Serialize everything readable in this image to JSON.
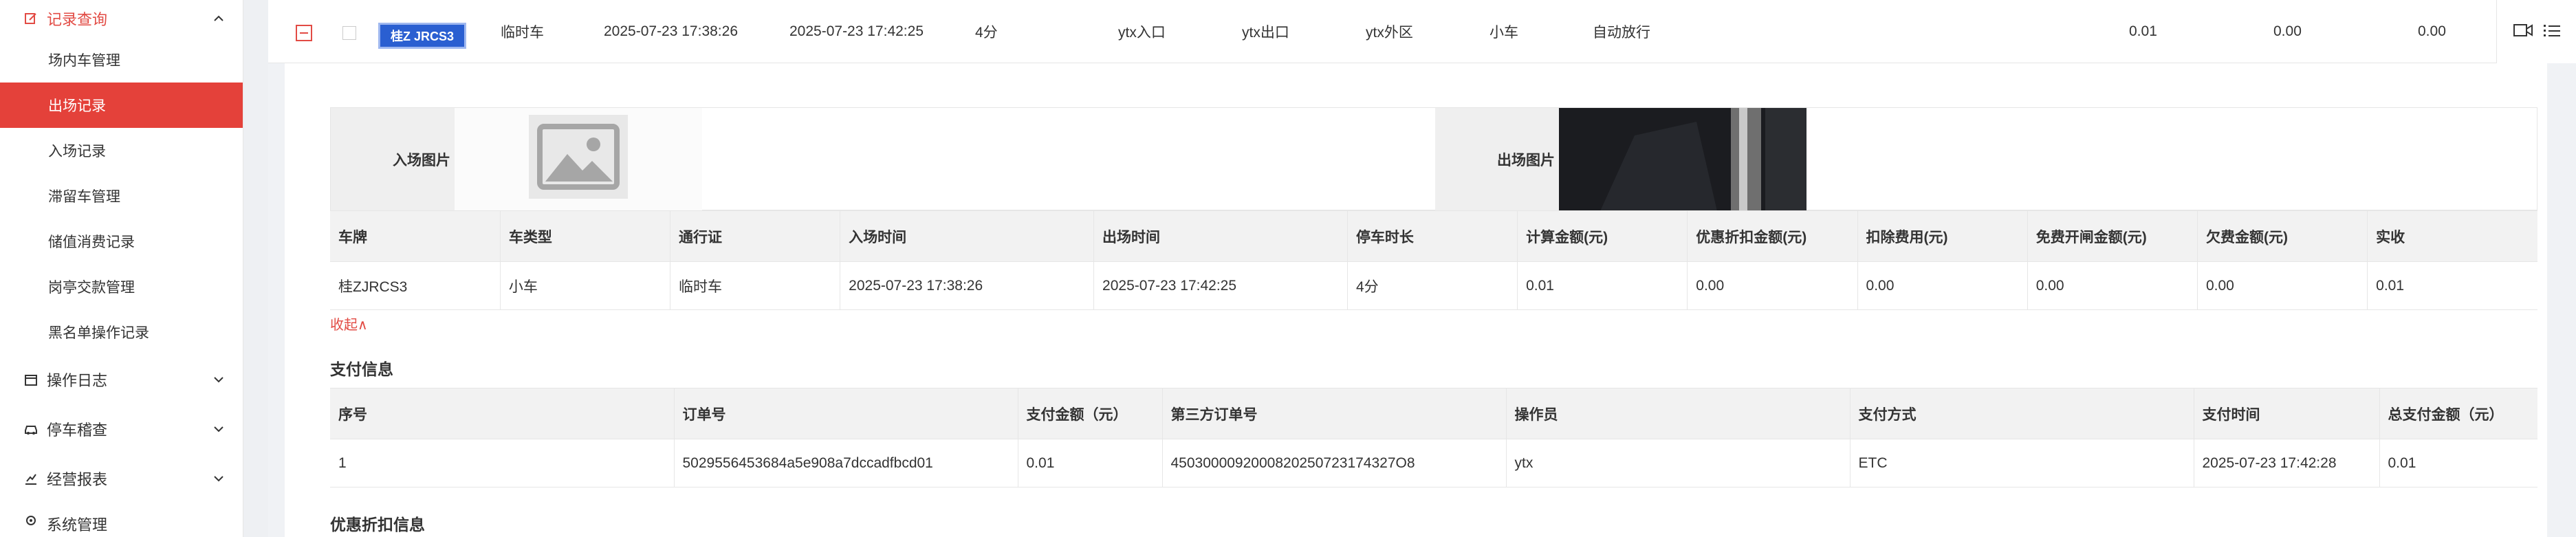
{
  "sidebar": {
    "record_query": "记录查询",
    "sub_items": [
      "场内车管理",
      "出场记录",
      "入场记录",
      "滞留车管理",
      "储值消费记录",
      "岗亭交款管理",
      "黑名单操作记录"
    ],
    "active_index": 1,
    "groups": [
      "操作日志",
      "停车稽查",
      "经营报表",
      "系统管理"
    ]
  },
  "row": {
    "plate": "桂Z JRCS3",
    "car_kind": "临时车",
    "in_time": "2025-07-23 17:38:26",
    "out_time": "2025-07-23 17:42:25",
    "duration": "4分",
    "in_gate": "ytx入口",
    "out_gate": "ytx出口",
    "area": "ytx外区",
    "car_type": "小车",
    "release": "自动放行",
    "amount1": "0.01",
    "amount2": "0.00",
    "amount3": "0.00"
  },
  "images": {
    "in_label": "入场图片",
    "out_label": "出场图片"
  },
  "detail": {
    "headers": [
      "车牌",
      "车类型",
      "通行证",
      "入场时间",
      "出场时间",
      "停车时长",
      "计算金额(元)",
      "优惠折扣金额(元)",
      "扣除费用(元)",
      "免费开闸金额(元)",
      "欠费金额(元)",
      "实收"
    ],
    "values": [
      "桂ZJRCS3",
      "小车",
      "临时车",
      "2025-07-23 17:38:26",
      "2025-07-23 17:42:25",
      "4分",
      "0.01",
      "0.00",
      "0.00",
      "0.00",
      "0.00",
      "0.01"
    ]
  },
  "collapse": "收起∧",
  "payment": {
    "title": "支付信息",
    "headers": [
      "序号",
      "订单号",
      "支付金额（元）",
      "第三方订单号",
      "操作员",
      "支付方式",
      "支付时间",
      "总支付金额（元）"
    ],
    "values": [
      "1",
      "5029556453684a5e908a7dccadfbcd01",
      "0.01",
      "4503000092000820250723174327O8",
      "ytx",
      "ETC",
      "2025-07-23 17:42:28",
      "0.01"
    ]
  },
  "discount": {
    "title": "优惠折扣信息"
  }
}
